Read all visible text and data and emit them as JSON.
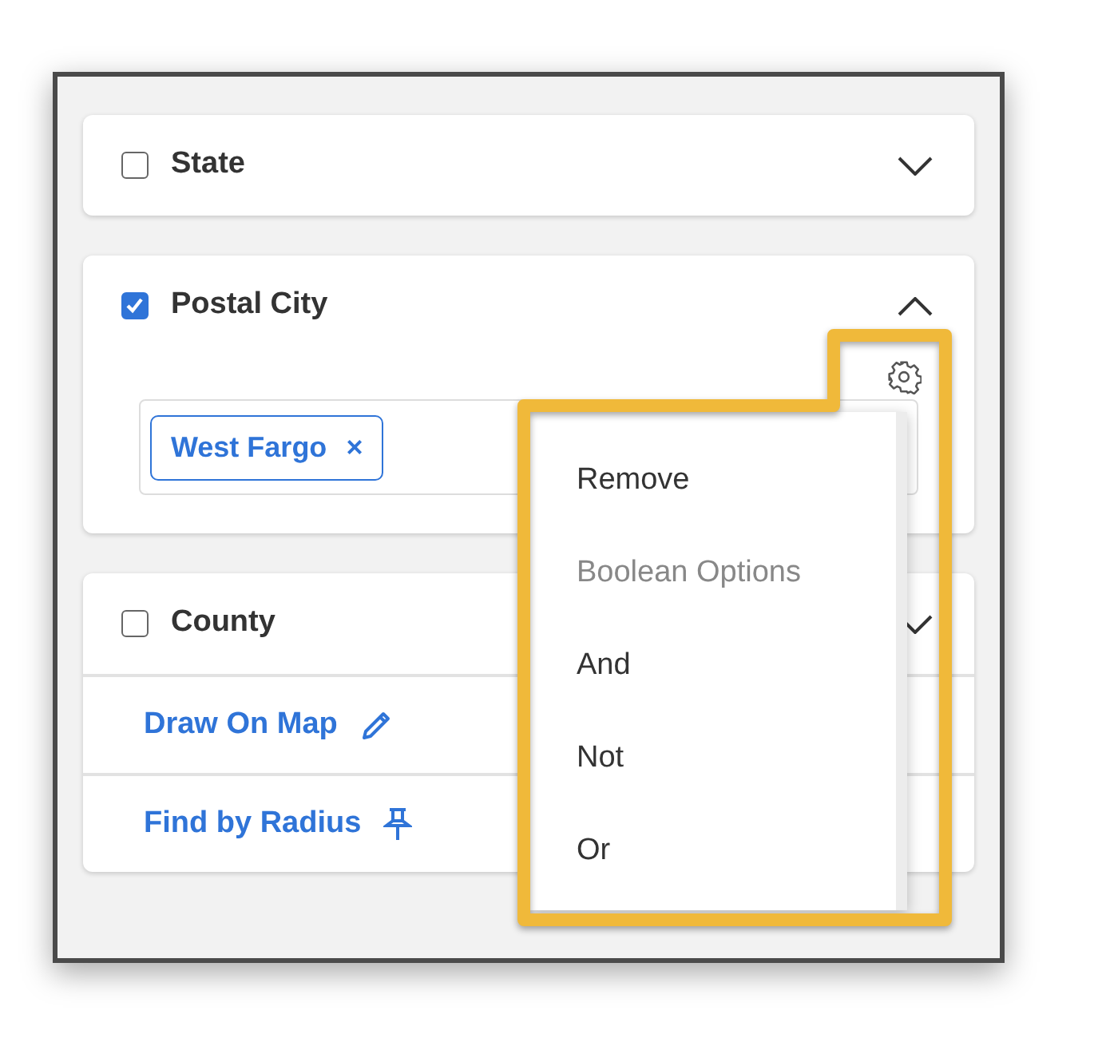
{
  "filters": [
    {
      "label": "State",
      "checked": false,
      "expanded": false
    },
    {
      "label": "Postal City",
      "checked": true,
      "expanded": true,
      "tags": [
        {
          "label": "West Fargo",
          "remove": "×"
        }
      ]
    },
    {
      "label": "County",
      "checked": false,
      "expanded": false
    }
  ],
  "links": [
    {
      "label": "Draw On Map",
      "kind": "pencil"
    },
    {
      "label": "Find by Radius",
      "kind": "pin"
    }
  ],
  "menu": {
    "items": [
      {
        "label": "Remove",
        "kind": "action"
      },
      {
        "label": "Boolean Options",
        "kind": "header"
      },
      {
        "label": "And",
        "kind": "action"
      },
      {
        "label": "Not",
        "kind": "action"
      },
      {
        "label": "Or",
        "kind": "action"
      }
    ]
  }
}
